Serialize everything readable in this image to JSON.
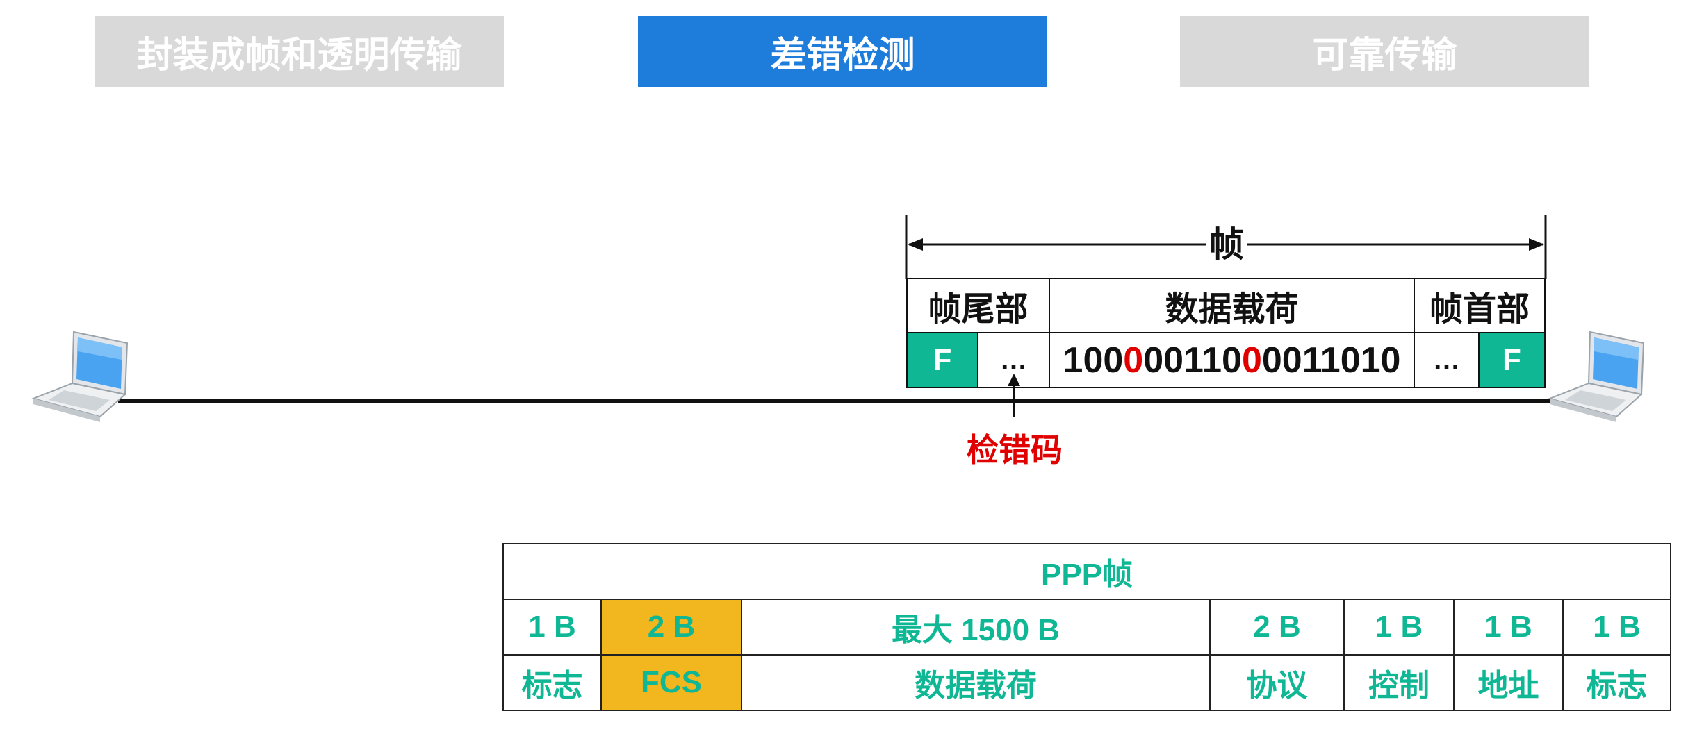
{
  "tabs": [
    {
      "label": "封装成帧和透明传输",
      "active": false
    },
    {
      "label": "差错检测",
      "active": true
    },
    {
      "label": "可靠传输",
      "active": false
    }
  ],
  "colors": {
    "tab_active": "#1e7ddb",
    "tab_inactive": "#d9d9d9",
    "accent_green": "#10b795",
    "highlight_yellow": "#f2b61f",
    "error_red": "#e00000"
  },
  "frame": {
    "span_label": "帧",
    "trailer_label": "帧尾部",
    "payload_label": "数据载荷",
    "header_label": "帧首部",
    "flag_left": "F",
    "flag_right": "F",
    "ellipsis_left": "…",
    "ellipsis_right": "…",
    "bits": [
      {
        "text": "100",
        "error": false
      },
      {
        "text": "0",
        "error": true
      },
      {
        "text": "00110",
        "error": false
      },
      {
        "text": "0",
        "error": true
      },
      {
        "text": "0",
        "error": false
      },
      {
        "text": "011010",
        "error": false
      }
    ]
  },
  "error_code_label": "检错码",
  "ppp": {
    "title": "PPP帧",
    "sizes": [
      "1 B",
      "2 B",
      "最大 1500 B",
      "2 B",
      "1 B",
      "1 B",
      "1 B"
    ],
    "fields": [
      "标志",
      "FCS",
      "数据载荷",
      "协议",
      "控制",
      "地址",
      "标志"
    ],
    "highlight_index": 1
  },
  "icons": {
    "left_host": "laptop-icon",
    "right_host": "laptop-icon"
  }
}
